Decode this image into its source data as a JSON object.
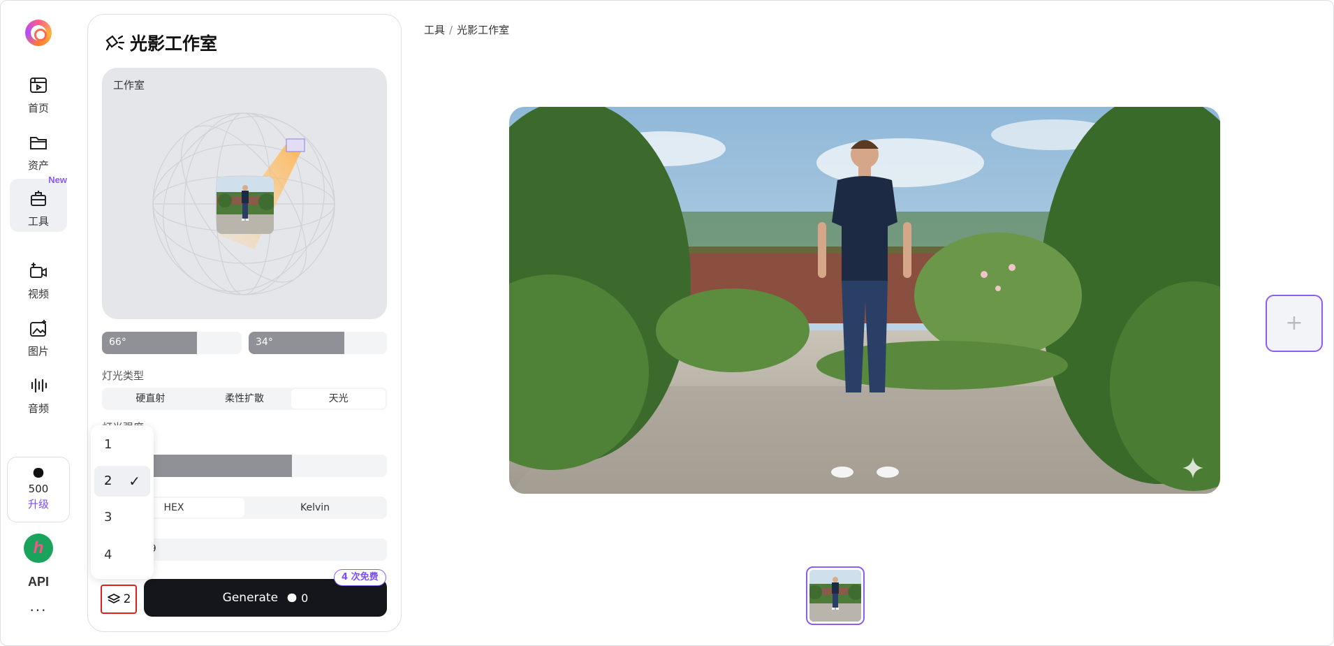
{
  "nav": {
    "items": [
      {
        "label": "首页",
        "icon": "home-icon"
      },
      {
        "label": "资产",
        "icon": "folder-icon"
      },
      {
        "label": "工具",
        "icon": "toolbox-icon",
        "badge": "New"
      },
      {
        "label": "视频",
        "icon": "video-icon"
      },
      {
        "label": "图片",
        "icon": "image-icon"
      },
      {
        "label": "音频",
        "icon": "audio-icon"
      }
    ],
    "credits": {
      "icon": "shell-icon",
      "value": "500",
      "upgrade_label": "升级"
    },
    "api_label": "API",
    "more": "···"
  },
  "panel": {
    "title": "光影工作室",
    "studio_label": "工作室",
    "angles": [
      {
        "value": "66°",
        "fill": 0.68
      },
      {
        "value": "34°",
        "fill": 0.69
      }
    ],
    "light_type": {
      "label": "灯光类型",
      "options": [
        "硬直射",
        "柔性扩散",
        "天光"
      ],
      "selected": "天光"
    },
    "intensity": {
      "label": "灯光强度",
      "fill": 0.67
    },
    "color_mode": {
      "options": [
        "HEX",
        "Kelvin"
      ],
      "selected": "HEX"
    },
    "hex_value": "99",
    "count_dropdown": {
      "options": [
        "1",
        "2",
        "3",
        "4"
      ],
      "selected": "2"
    },
    "count_value": "2",
    "generate": {
      "label": "Generate",
      "cost": "0",
      "free_badge": "4 次免费"
    }
  },
  "main": {
    "breadcrumb": {
      "root": "工具",
      "sep": "/",
      "current": "光影工作室"
    },
    "add_label": "+"
  },
  "colors": {
    "accent": "#8b5cf6",
    "dark": "#14161c",
    "highlight": "#e02020"
  }
}
